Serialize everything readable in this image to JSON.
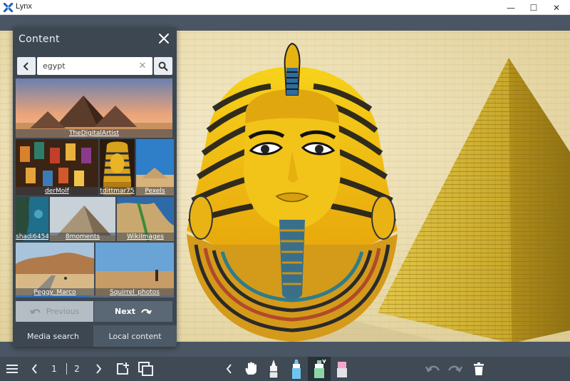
{
  "window": {
    "title": "Lynx",
    "minimize": "—",
    "maximize": "☐",
    "close": "✕"
  },
  "panel": {
    "title": "Content",
    "search": {
      "value": "egypt"
    },
    "results": [
      {
        "caption": "TheDigitalArtist"
      },
      {
        "caption": "derMolf"
      },
      {
        "caption": "tdittmar75"
      },
      {
        "caption": "Pexels"
      },
      {
        "caption": "shadi6454"
      },
      {
        "caption": "8moments"
      },
      {
        "caption": "WikiImages"
      },
      {
        "caption": "Peggy_Marco"
      },
      {
        "caption": "Squirrel_photos"
      }
    ],
    "scroll_progress": 0.47,
    "prev_label": "Previous",
    "next_label": "Next",
    "tabs": {
      "media": "Media search",
      "local": "Local content"
    }
  },
  "toolbar": {
    "page_current": "1",
    "page_total": "2",
    "icons": [
      "menu-icon",
      "prev-page-icon",
      "next-page-icon",
      "add-page-icon",
      "pages-icon",
      "collapse-icon",
      "hand-icon",
      "pen-icon",
      "marker-icon",
      "highlighter-icon",
      "eraser-icon",
      "undo-icon",
      "redo-icon",
      "delete-icon"
    ],
    "active_tool": "highlighter",
    "colors": {
      "marker": "#6ec6f0",
      "highlighter": "#8bd6a6",
      "eraser": "#f4a6c8"
    }
  },
  "colors": {
    "panel_bg": "#3d4752",
    "toolbar_bg": "#3f4a55",
    "accent": "#2f6db5",
    "canvas_bg": "#ecdfb3"
  }
}
